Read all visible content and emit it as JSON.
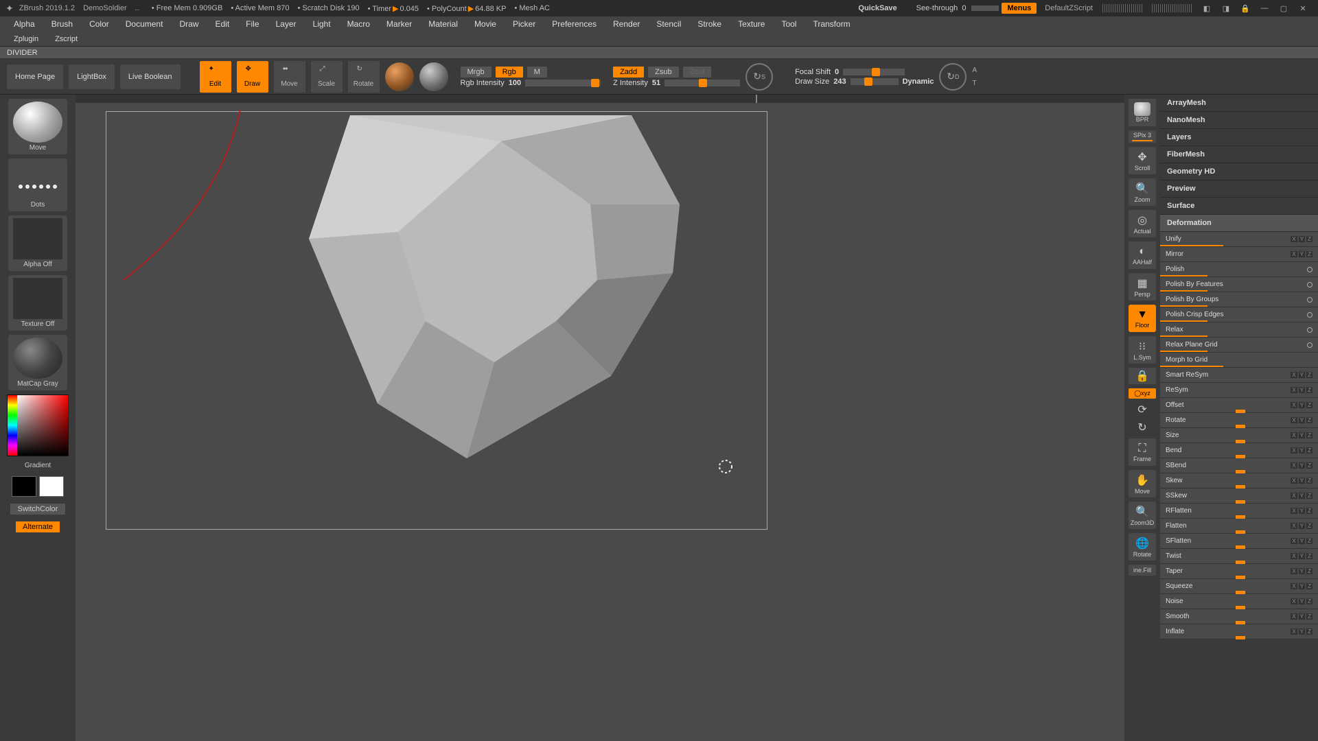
{
  "titlebar": {
    "app": "ZBrush 2019.1.2",
    "project": "DemoSoldier",
    "dots": "..",
    "freemem": "Free Mem 0.909GB",
    "activemem": "Active Mem 870",
    "scratch": "Scratch Disk 190",
    "timer": "Timer",
    "timer_val": "0.045",
    "polycount": "PolyCount",
    "polycount_val": "64.88 KP",
    "mesh": "Mesh",
    "mesh_val": "AC",
    "quicksave": "QuickSave",
    "seethrough": "See-through",
    "seethrough_val": "0",
    "menus": "Menus",
    "dzs": "DefaultZScript"
  },
  "menubar": [
    "Alpha",
    "Brush",
    "Color",
    "Document",
    "Draw",
    "Edit",
    "File",
    "Layer",
    "Light",
    "Macro",
    "Marker",
    "Material",
    "Movie",
    "Picker",
    "Preferences",
    "Render",
    "Stencil",
    "Stroke",
    "Texture",
    "Tool",
    "Transform"
  ],
  "menubar2": [
    "Zplugin",
    "Zscript"
  ],
  "divider": "DIVIDER",
  "toolshelf": {
    "home": "Home Page",
    "lightbox": "LightBox",
    "liveboolean": "Live Boolean",
    "edit": "Edit",
    "draw": "Draw",
    "move": "Move",
    "scale": "Scale",
    "rotate": "Rotate",
    "mrgb": "Mrgb",
    "rgb": "Rgb",
    "m": "M",
    "zadd": "Zadd",
    "zsub": "Zsub",
    "zcut": "Zcut",
    "rgb_intensity_label": "Rgb Intensity",
    "rgb_intensity_val": "100",
    "z_intensity_label": "Z Intensity",
    "z_intensity_val": "51",
    "focal_shift_label": "Focal Shift",
    "focal_shift_val": "0",
    "draw_size_label": "Draw Size",
    "draw_size_val": "243",
    "dynamic": "Dynamic",
    "s_label": "S",
    "d_label": "D",
    "a_label": "A",
    "t_label": "T"
  },
  "left": {
    "brush_label": "Move",
    "stroke_label": "Dots",
    "alpha_label": "Alpha Off",
    "texture_label": "Texture Off",
    "material_label": "MatCap Gray",
    "gradient": "Gradient",
    "switch": "SwitchColor",
    "alternate": "Alternate"
  },
  "vtool": {
    "bpr": "BPR",
    "spix": "SPix 3",
    "scroll": "Scroll",
    "zoom": "Zoom",
    "actual": "Actual",
    "aahalf": "AAHalf",
    "persp": "Persp",
    "floor": "Floor",
    "lsym": "L.Sym",
    "xyz": "xyz",
    "frame": "Frame",
    "move": "Move",
    "zoom3d": "Zoom3D",
    "rotate": "Rotate",
    "inefill": "ine.Fill"
  },
  "palette": {
    "sections": [
      "ArrayMesh",
      "NanoMesh",
      "Layers",
      "FiberMesh",
      "Geometry HD",
      "Preview",
      "Surface"
    ],
    "deformation": "Deformation",
    "items": [
      {
        "name": "Unify",
        "type": "button",
        "badges": [
          "X",
          "Y",
          "Z"
        ],
        "bar": 40,
        "dot": false
      },
      {
        "name": "Mirror",
        "type": "button",
        "badges": [
          "X",
          "Y",
          "Z"
        ],
        "bar": 0,
        "dot": false
      },
      {
        "name": "Polish",
        "type": "button",
        "badges": [],
        "bar": 30,
        "dot": true
      },
      {
        "name": "Polish By Features",
        "type": "button",
        "badges": [],
        "bar": 30,
        "dot": true
      },
      {
        "name": "Polish By Groups",
        "type": "button",
        "badges": [],
        "bar": 30,
        "dot": true
      },
      {
        "name": "Polish Crisp Edges",
        "type": "button",
        "badges": [],
        "bar": 30,
        "dot": true
      },
      {
        "name": "Relax",
        "type": "button",
        "badges": [],
        "bar": 30,
        "dot": true
      },
      {
        "name": "Relax Plane Grid",
        "type": "button",
        "badges": [],
        "bar": 30,
        "dot": true
      },
      {
        "name": "Morph to Grid",
        "type": "button",
        "badges": [],
        "bar": 40,
        "dot": false
      },
      {
        "name": "Smart ReSym",
        "type": "button",
        "badges": [
          "X",
          "Y",
          "Z"
        ],
        "bar": 0,
        "dot": false
      },
      {
        "name": "ReSym",
        "type": "button",
        "badges": [
          "X",
          "Y",
          "Z"
        ],
        "bar": 0,
        "dot": false
      },
      {
        "name": "Offset",
        "type": "slider",
        "badges": [
          "X",
          "Y",
          "Z"
        ]
      },
      {
        "name": "Rotate",
        "type": "slider",
        "badges": [
          "X",
          "Y",
          "Z"
        ]
      },
      {
        "name": "Size",
        "type": "slider",
        "badges": [
          "X",
          "Y",
          "Z"
        ]
      },
      {
        "name": "Bend",
        "type": "slider",
        "badges": [
          "X",
          "Y",
          "Z"
        ]
      },
      {
        "name": "SBend",
        "type": "slider",
        "badges": [
          "X",
          "Y",
          "Z"
        ]
      },
      {
        "name": "Skew",
        "type": "slider",
        "badges": [
          "X",
          "Y",
          "Z"
        ]
      },
      {
        "name": "SSkew",
        "type": "slider",
        "badges": [
          "X",
          "Y",
          "Z"
        ]
      },
      {
        "name": "RFlatten",
        "type": "slider",
        "badges": [
          "X",
          "Y",
          "Z"
        ]
      },
      {
        "name": "Flatten",
        "type": "slider",
        "badges": [
          "X",
          "Y",
          "Z"
        ]
      },
      {
        "name": "SFlatten",
        "type": "slider",
        "badges": [
          "X",
          "Y",
          "Z"
        ]
      },
      {
        "name": "Twist",
        "type": "slider",
        "badges": [
          "X",
          "Y",
          "Z"
        ]
      },
      {
        "name": "Taper",
        "type": "slider",
        "badges": [
          "X",
          "Y",
          "Z"
        ]
      },
      {
        "name": "Squeeze",
        "type": "slider",
        "badges": [
          "X",
          "Y",
          "Z"
        ]
      },
      {
        "name": "Noise",
        "type": "slider",
        "badges": [
          "X",
          "Y",
          "Z"
        ]
      },
      {
        "name": "Smooth",
        "type": "slider",
        "badges": [
          "X",
          "Y",
          "Z"
        ]
      },
      {
        "name": "Inflate",
        "type": "slider",
        "badges": [
          "X",
          "Y",
          "Z"
        ]
      }
    ]
  }
}
